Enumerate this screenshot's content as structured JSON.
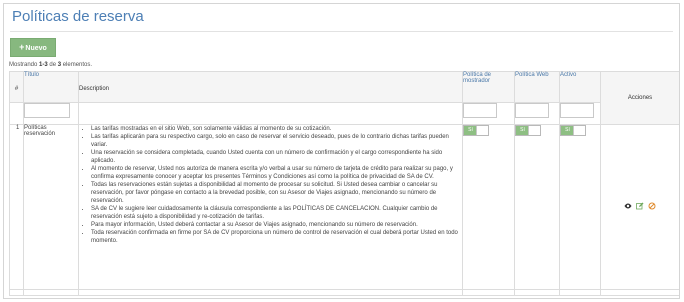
{
  "page": {
    "title": "Políticas de reserva"
  },
  "toolbar": {
    "new_label": "Nuevo",
    "new_icon": "plus-icon"
  },
  "summary": {
    "prefix": "Mostrando ",
    "range": "1-3",
    "middle": " de ",
    "total": "3",
    "suffix": " elementos."
  },
  "table": {
    "headers": {
      "hash": "#",
      "title": "Título",
      "description": "Description",
      "counter": "Política de mostrador",
      "web": "Política Web",
      "active": "Activo",
      "actions": "Acciones"
    },
    "rows": [
      {
        "num": "1",
        "title": "Políticas reservación",
        "description": [
          "Las tarifas mostradas en el sitio Web, son solamente válidas al momento de su cotización.",
          "Las tarifas aplicarán para su respectivo cargo, solo en caso de reservar el servicio deseado, pues de lo contrario dichas tarifas pueden variar.",
          "Una reservación se considera completada, cuando Usted cuenta con un número de confirmación y el cargo correspondiente ha sido aplicado.",
          "Al momento de reservar, Usted nos autoriza de manera escrita y/o verbal a usar su número de tarjeta de crédito para realizar su pago, y confirma expresamente conocer y aceptar los presentes Términos y Condiciones así como la política de privacidad de                    SA de CV.",
          "Todas las reservaciones están sujetas a disponibilidad al momento de procesar su solicitud. Si Usted desea cambiar o cancelar su reservación, por favor póngase en contacto a la brevedad posible, con su Asesor de Viajes asignado, mencionando su número de reservación.",
          "                    SA de CV le sugiere leer cuidadosamente la cláusula correspondiente a las POLÍTICAS DE CANCELACION. Cualquier cambio de reservación está sujeto a disponibilidad y re-cotización de tarifas.",
          "Para mayor información, Usted deberá contactar a su Asesor de Viajes asignado, mencionando su número de reservación.",
          "Toda reservación confirmada en firme por                    SA de CV proporciona un número de control de reservación el cual deberá portar Usted en todo momento."
        ],
        "counter_toggle": "Sí",
        "web_toggle": "Sí",
        "active_toggle": "Sí",
        "actions": {
          "view_icon": "eye-icon",
          "edit_icon": "pencil-icon",
          "delete_icon": "ban-icon"
        }
      }
    ]
  },
  "colors": {
    "title": "#4d7fb5",
    "header_link": "#4a78a8",
    "new_button": "#87b87f",
    "toggle_on": "#8ebf83",
    "edit_icon": "#6fa85c",
    "delete_icon": "#e08a2c"
  }
}
